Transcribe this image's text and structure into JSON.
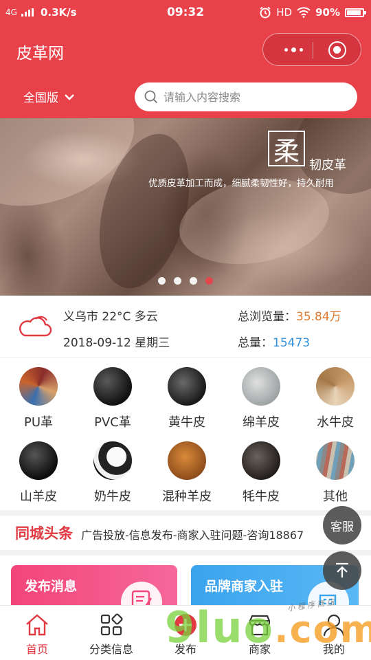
{
  "status_bar": {
    "network": "4G",
    "speed": "0.3K/s",
    "time": "09:32",
    "hd": "HD",
    "battery": "90%",
    "battery_level": 0.9
  },
  "header": {
    "title": "皮革网",
    "region": "全国版",
    "search_placeholder": "请输入内容搜索"
  },
  "banner": {
    "big_char": "柔",
    "title": "韧皮革",
    "subtitle": "优质皮革加工而成，细腻柔韧性好，持久耐用",
    "slide_count": 4,
    "active_slide": 4
  },
  "info": {
    "weather": "义乌市 22°C 多云",
    "date": "2018-09-12 星期三",
    "views_label": "总浏览量：",
    "views_value": "35.84万",
    "total_label": "总量：",
    "total_value": "15473"
  },
  "categories": [
    {
      "label": "PU革",
      "icon": "pu-leather-thumb"
    },
    {
      "label": "PVC革",
      "icon": "pvc-leather-thumb"
    },
    {
      "label": "黄牛皮",
      "icon": "cowhide-thumb"
    },
    {
      "label": "绵羊皮",
      "icon": "sheepskin-thumb"
    },
    {
      "label": "水牛皮",
      "icon": "buffalo-thumb"
    },
    {
      "label": "山羊皮",
      "icon": "goatskin-thumb"
    },
    {
      "label": "奶牛皮",
      "icon": "dairy-cow-thumb"
    },
    {
      "label": "混种羊皮",
      "icon": "mixed-sheep-thumb"
    },
    {
      "label": "牦牛皮",
      "icon": "yak-thumb"
    },
    {
      "label": "其他",
      "icon": "other-thumb"
    }
  ],
  "headline": {
    "label": "同城头条",
    "text": "广告投放-信息发布-商家入驻问题-咨询18867"
  },
  "cards": {
    "publish": "发布消息",
    "brand": "品牌商家入驻"
  },
  "floating": {
    "service": "客服"
  },
  "tabs": [
    {
      "label": "首页",
      "icon": "home-icon"
    },
    {
      "label": "分类信息",
      "icon": "category-icon"
    },
    {
      "label": "发布",
      "icon": "publish-icon"
    },
    {
      "label": "商家",
      "icon": "store-icon"
    },
    {
      "label": "我的",
      "icon": "user-icon"
    }
  ],
  "watermark": {
    "main": "9luo",
    "suffix": ".com",
    "note": "小 程 序 商 店"
  },
  "colors": {
    "brand_red": "#e8414a",
    "views_orange": "#e07a2e",
    "total_blue": "#2f8fd6"
  }
}
